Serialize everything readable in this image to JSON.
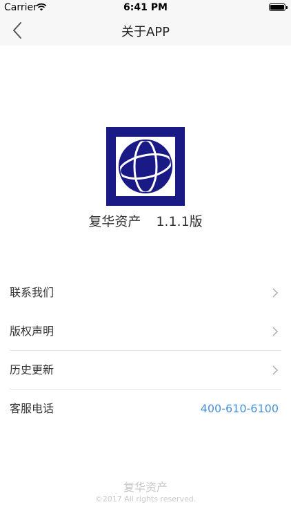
{
  "status_bar": {
    "carrier": "Carrier",
    "time": "6:41 PM"
  },
  "nav": {
    "title": "关于APP"
  },
  "app": {
    "name": "复华资产",
    "version": "1.1.1版",
    "logo_color": "#1a1a86"
  },
  "menu": {
    "items": [
      {
        "label": "联系我们"
      },
      {
        "label": "版权声明"
      },
      {
        "label": "历史更新"
      },
      {
        "label": "客服电话",
        "value": "400-610-6100"
      }
    ]
  },
  "footer": {
    "name": "复华资产",
    "copyright": "©2017 All rights reserved."
  },
  "colors": {
    "accent": "#4a90d9",
    "nav_bg": "#f7f7f7"
  }
}
